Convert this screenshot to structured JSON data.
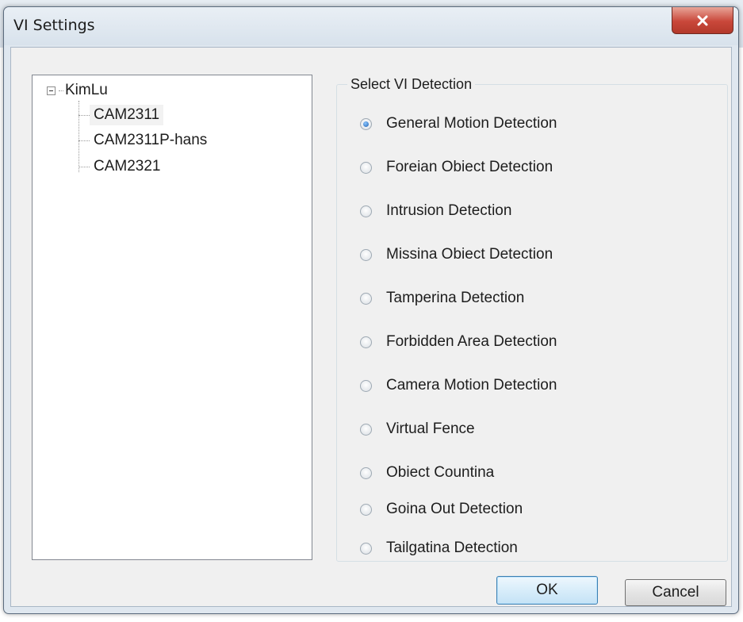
{
  "window": {
    "title": "VI Settings",
    "close_glyph": "x"
  },
  "tree": {
    "root_label": "KimLu",
    "items": [
      {
        "label": "CAM2311",
        "selected": true
      },
      {
        "label": "CAM2311P-hans",
        "selected": false
      },
      {
        "label": "CAM2321",
        "selected": false
      }
    ]
  },
  "detection": {
    "group_label": "Select VI Detection",
    "options": [
      {
        "label": "General Motion Detection",
        "checked": true
      },
      {
        "label": "Foreian Obiect Detection",
        "checked": false
      },
      {
        "label": "Intrusion Detection",
        "checked": false
      },
      {
        "label": "Missina Obiect Detection",
        "checked": false
      },
      {
        "label": "Tamperina Detection",
        "checked": false
      },
      {
        "label": "Forbidden Area Detection",
        "checked": false
      },
      {
        "label": "Camera Motion Detection",
        "checked": false
      },
      {
        "label": "Virtual Fence",
        "checked": false
      },
      {
        "label": "Obiect Countina",
        "checked": false
      },
      {
        "label": "Goina Out Detection",
        "checked": false
      },
      {
        "label": "Tailgatina Detection",
        "checked": false
      }
    ]
  },
  "buttons": {
    "ok_label": "OK",
    "cancel_label": "Cancel"
  },
  "colors": {
    "close_button": "#c9473a",
    "radio_selected": "#1d5fb0",
    "default_button_border": "#3c7fb1"
  }
}
